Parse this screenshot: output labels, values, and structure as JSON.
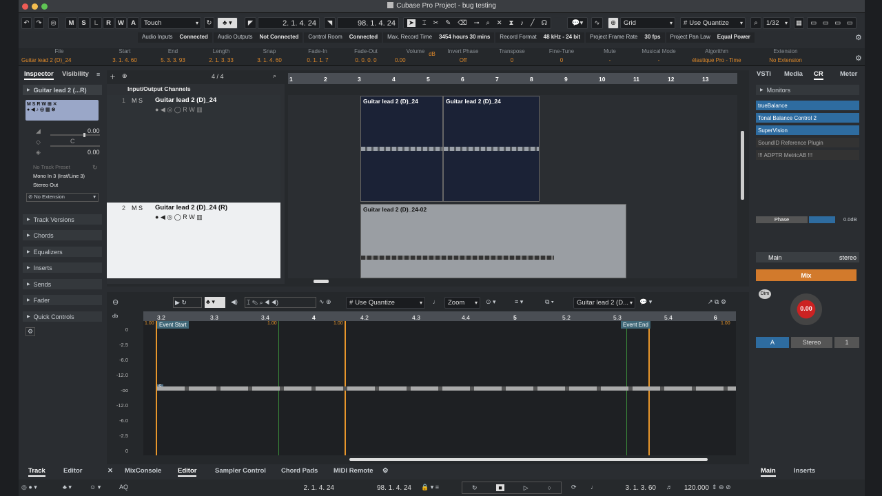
{
  "window": {
    "title": "Cubase Pro Project - bug testing"
  },
  "toolbar": {
    "modes": [
      "M",
      "S",
      "L",
      "R",
      "W",
      "A"
    ],
    "automation_mode": "Touch",
    "pos1": "2. 1. 4. 24",
    "pos2": "98. 1. 4. 24",
    "snap_type": "Grid",
    "quantize": "Use Quantize",
    "quantize_value": "1/32"
  },
  "status": [
    {
      "label": "Audio Inputs",
      "value": "Connected"
    },
    {
      "label": "Audio Outputs",
      "value": "Not Connected"
    },
    {
      "label": "Control Room",
      "value": "Connected"
    },
    {
      "label": "Max. Record Time",
      "value": "3454 hours 30 mins"
    },
    {
      "label": "Record Format",
      "value": "48 kHz - 24 bit"
    },
    {
      "label": "Project Frame Rate",
      "value": "30 fps"
    },
    {
      "label": "Project Pan Law",
      "value": "Equal Power"
    }
  ],
  "infoline": [
    {
      "h": "File",
      "v": "Guitar lead 2 (D)_24"
    },
    {
      "h": "Start",
      "v": "3. 1. 4. 60"
    },
    {
      "h": "End",
      "v": "5. 3. 3. 93"
    },
    {
      "h": "Length",
      "v": "2. 1. 3. 33"
    },
    {
      "h": "Snap",
      "v": "3. 1. 4. 60"
    },
    {
      "h": "Fade-In",
      "v": "0. 1. 1. 7"
    },
    {
      "h": "Fade-Out",
      "v": "0. 0. 0. 0"
    },
    {
      "h": "Volume",
      "v": "0.00"
    },
    {
      "h": "",
      "v": "dB"
    },
    {
      "h": "Invert Phase",
      "v": "Off"
    },
    {
      "h": "Transpose",
      "v": "0"
    },
    {
      "h": "Fine-Tune",
      "v": "0"
    },
    {
      "h": "Mute",
      "v": "-"
    },
    {
      "h": "Musical Mode",
      "v": "-"
    },
    {
      "h": "Algorithm",
      "v": "élastique Pro - Time"
    },
    {
      "h": "Extension",
      "v": "No Extension"
    }
  ],
  "inspector": {
    "tabs": [
      "Inspector",
      "Visibility"
    ],
    "track_name": "Guitar lead 2 (...R)",
    "vol": "0.00",
    "pan": "C",
    "vol2": "0.00",
    "preset": "No Track Preset",
    "input": "Mono In 3 (Inst/Line 3)",
    "output": "Stereo Out",
    "extension": "No Extension",
    "sections": [
      "Track Versions",
      "Chords",
      "Equalizers",
      "Inserts",
      "Sends",
      "Fader",
      "Quick Controls"
    ]
  },
  "project": {
    "counter": "4 / 4",
    "folder": "Input/Output Channels",
    "tracks": [
      {
        "num": "1",
        "name": "Guitar lead 2 (D)_24"
      },
      {
        "num": "2",
        "name": "Guitar lead 2 (D)_24 (R)"
      }
    ],
    "ruler": [
      "1",
      "2",
      "3",
      "4",
      "5",
      "6",
      "7",
      "8",
      "9",
      "10",
      "11",
      "12",
      "13"
    ],
    "events": [
      "Guitar lead 2 (D)_24",
      "Guitar lead 2 (D)_24",
      "Guitar lead 2 (D)_24-02"
    ]
  },
  "editor": {
    "quantize": "Use Quantize",
    "zoom": "Zoom",
    "clip": "Guitar lead 2 (D...",
    "ruler": [
      "3.2",
      "3.3",
      "3.4",
      "4",
      "4.2",
      "4.3",
      "4.4",
      "5",
      "5.2",
      "5.3",
      "5.4",
      "6"
    ],
    "db_labels": [
      "0",
      "-2.5",
      "-6.0",
      "-12.0",
      "-oo",
      "-12.0",
      "-6.0",
      "-2.5",
      "0"
    ],
    "event_start": "Event Start",
    "event_end": "Event End",
    "s_marker": "S",
    "marker_values": [
      "1.00",
      "1.00",
      "1.00",
      "1.00"
    ]
  },
  "right": {
    "tabs": [
      "VSTi",
      "Media",
      "CR",
      "Meter"
    ],
    "monitors_title": "Monitors",
    "plugins": [
      "trueBalance",
      "Tonal Balance Control 2",
      "SuperVision",
      "SoundID Reference Plugin",
      "!!! ADPTR MetricAB !!!"
    ],
    "phase": "Phase",
    "phase_val": "0.0dB",
    "main": "Main",
    "stereo": "stereo",
    "mix": "Mix",
    "dim": "Dim",
    "knob": "0.00",
    "out_a": "A",
    "out_stereo": "Stereo",
    "out_1": "1"
  },
  "bottom_tabs": {
    "left": [
      "Track",
      "Editor"
    ],
    "center": [
      "MixConsole",
      "Editor",
      "Sampler Control",
      "Chord Pads",
      "MIDI Remote"
    ],
    "right": [
      "Main",
      "Inserts"
    ]
  },
  "transport": {
    "aq": "AQ",
    "pos_left": "2. 1. 4. 24",
    "pos_right": "98. 1. 4. 24",
    "position": "3. 1. 3. 60",
    "tempo": "120.000"
  }
}
